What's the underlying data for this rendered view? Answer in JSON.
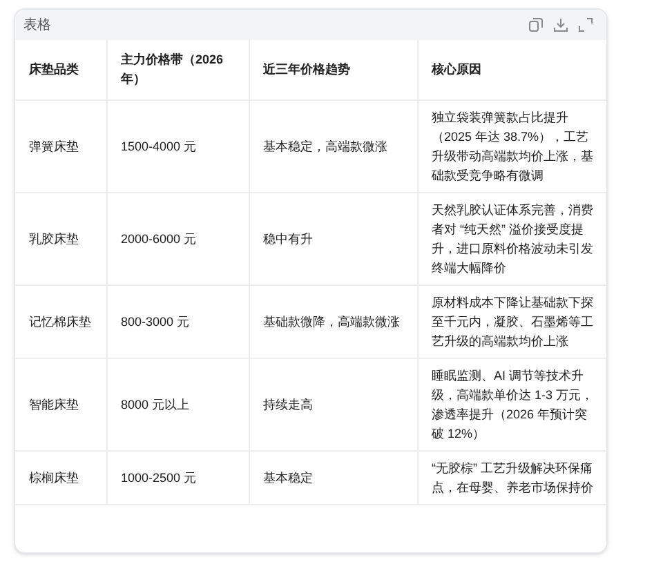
{
  "card": {
    "title": "表格"
  },
  "table": {
    "columns": [
      "床垫品类",
      "主力价格带（2026年）",
      "近三年价格趋势",
      "核心原因"
    ],
    "rows": [
      [
        "弹簧床垫",
        "1500-4000 元",
        "基本稳定，高端款微涨",
        "独立袋装弹簧款占比提升（2025 年达 38.7%），工艺升级带动高端款均价上涨，基础款受竞争略有微调"
      ],
      [
        "乳胶床垫",
        "2000-6000 元",
        "稳中有升",
        "天然乳胶认证体系完善，消费者对 “纯天然” 溢价接受度提升，进口原料价格波动未引发终端大幅降价"
      ],
      [
        "记忆棉床垫",
        "800-3000 元",
        "基础款微降，高端款微涨",
        "原材料成本下降让基础款下探至千元内，凝胶、石墨烯等工艺升级的高端款均价上涨"
      ],
      [
        "智能床垫",
        "8000 元以上",
        "持续走高",
        "睡眠监测、AI 调节等技术升级，高端款单价达 1-3 万元，渗透率提升（2026 年预计突破 12%）"
      ],
      [
        "棕榈床垫",
        "1000-2500 元",
        "基本稳定",
        "“无胶棕” 工艺升级解决环保痛点，在母婴、养老市场保持价"
      ]
    ]
  }
}
